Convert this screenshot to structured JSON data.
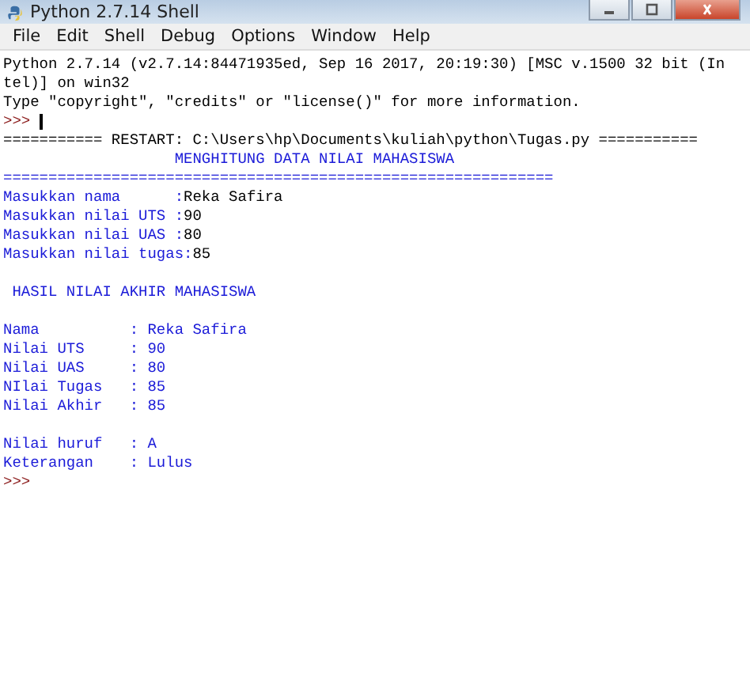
{
  "window": {
    "title": "Python 2.7.14 Shell"
  },
  "menu": [
    "File",
    "Edit",
    "Shell",
    "Debug",
    "Options",
    "Window",
    "Help"
  ],
  "shell_lines": [
    {
      "segments": [
        {
          "kind": "output",
          "text": "Python 2.7.14 (v2.7.14:84471935ed, Sep 16 2017, 20:19:30) [MSC v.1500 32 bit (In"
        }
      ]
    },
    {
      "segments": [
        {
          "kind": "output",
          "text": "tel)] on win32"
        }
      ]
    },
    {
      "segments": [
        {
          "kind": "output",
          "text": "Type \"copyright\", \"credits\" or \"license()\" for more information."
        }
      ]
    },
    {
      "segments": [
        {
          "kind": "prompt",
          "text": ">>>"
        },
        {
          "kind": "cursor"
        }
      ]
    },
    {
      "segments": [
        {
          "kind": "output",
          "text": "=========== RESTART: C:\\Users\\hp\\Documents\\kuliah\\python\\Tugas.py ==========="
        }
      ]
    },
    {
      "segments": [
        {
          "kind": "stdout",
          "text": "                   MENGHITUNG DATA NILAI MAHASISWA"
        }
      ]
    },
    {
      "segments": [
        {
          "kind": "stdout",
          "text": "============================================================="
        }
      ]
    },
    {
      "segments": [
        {
          "kind": "stdout",
          "text": "Masukkan nama      :"
        },
        {
          "kind": "input",
          "text": "Reka Safira"
        }
      ]
    },
    {
      "segments": [
        {
          "kind": "stdout",
          "text": "Masukkan nilai UTS :"
        },
        {
          "kind": "input",
          "text": "90"
        }
      ]
    },
    {
      "segments": [
        {
          "kind": "stdout",
          "text": "Masukkan nilai UAS :"
        },
        {
          "kind": "input",
          "text": "80"
        }
      ]
    },
    {
      "segments": [
        {
          "kind": "stdout",
          "text": "Masukkan nilai tugas:"
        },
        {
          "kind": "input",
          "text": "85"
        }
      ]
    },
    {
      "blank_before": true,
      "segments": [
        {
          "kind": "stdout",
          "text": " HASIL NILAI AKHIR MAHASISWA"
        }
      ]
    },
    {
      "blank_before": true,
      "segments": [
        {
          "kind": "stdout",
          "text": "Nama          : Reka Safira"
        }
      ]
    },
    {
      "segments": [
        {
          "kind": "stdout",
          "text": "Nilai UTS     : 90"
        }
      ]
    },
    {
      "segments": [
        {
          "kind": "stdout",
          "text": "Nilai UAS     : 80"
        }
      ]
    },
    {
      "segments": [
        {
          "kind": "stdout",
          "text": "NIlai Tugas   : 85"
        }
      ]
    },
    {
      "segments": [
        {
          "kind": "stdout",
          "text": "Nilai Akhir   : 85"
        }
      ]
    },
    {
      "blank_before": true,
      "segments": [
        {
          "kind": "stdout",
          "text": "Nilai huruf   : A"
        }
      ]
    },
    {
      "segments": [
        {
          "kind": "stdout",
          "text": "Keterangan    : Lulus"
        }
      ]
    },
    {
      "segments": [
        {
          "kind": "prompt",
          "text": ">>>"
        }
      ]
    }
  ]
}
